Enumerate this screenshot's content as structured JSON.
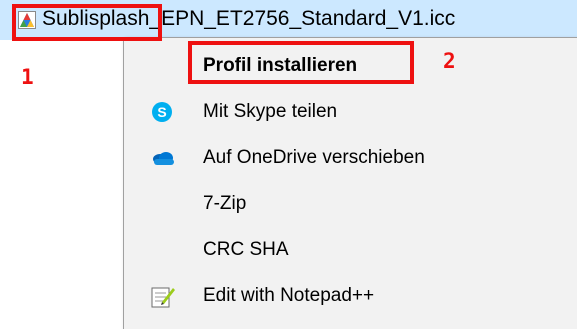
{
  "file_row": {
    "filename": "Sublisplash_EPN_ET2756_Standard_V1.icc",
    "icon": "color-profile-icon"
  },
  "context_menu": {
    "items": [
      {
        "label": "Profil installieren",
        "bold": true,
        "icon": ""
      },
      {
        "label": "Mit Skype teilen",
        "bold": false,
        "icon": "skype-icon"
      },
      {
        "label": "Auf OneDrive verschieben",
        "bold": false,
        "icon": "onedrive-icon"
      },
      {
        "label": "7-Zip",
        "bold": false,
        "icon": ""
      },
      {
        "label": "CRC SHA",
        "bold": false,
        "icon": ""
      },
      {
        "label": "Edit with Notepad++",
        "bold": false,
        "icon": "notepad-plus-plus-icon"
      }
    ]
  },
  "annotations": {
    "step1": "1",
    "step2": "2",
    "color": "#ee1111"
  },
  "colors": {
    "selection": "#cce8ff",
    "menu_bg": "#f2f2f2",
    "skype": "#00aff0",
    "onedrive": "#0364b8"
  }
}
